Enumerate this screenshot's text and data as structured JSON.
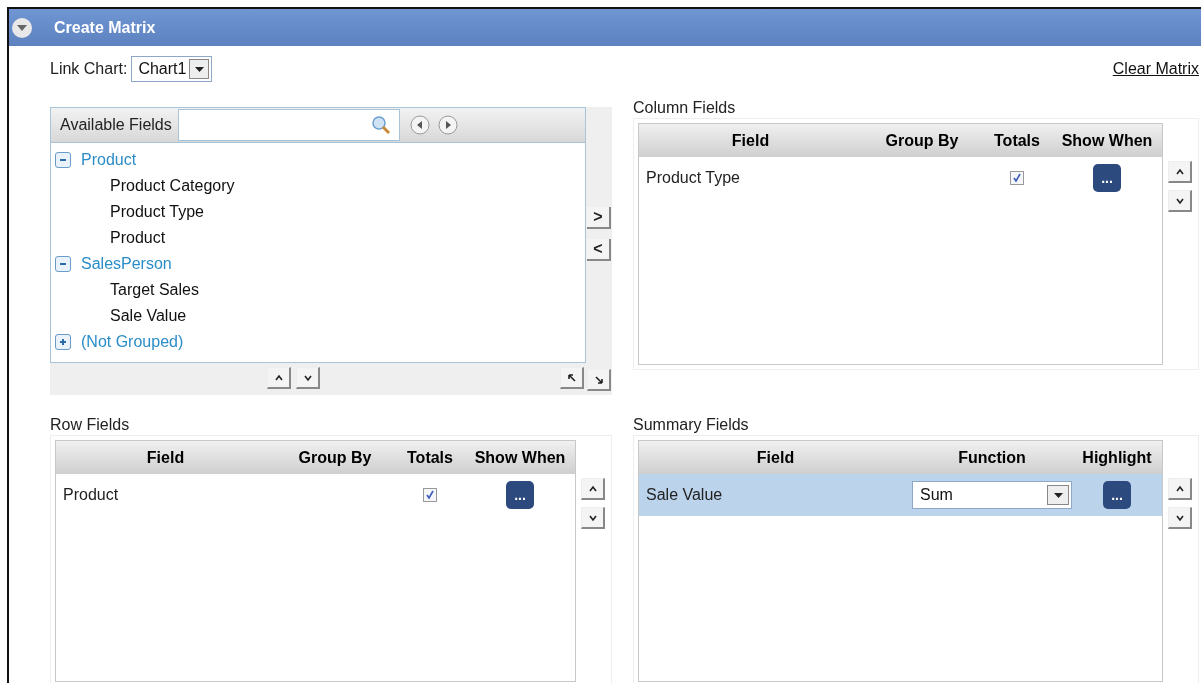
{
  "header": {
    "title": "Create Matrix",
    "expanded": true
  },
  "link_chart": {
    "label": "Link Chart:",
    "value": "Chart1"
  },
  "clear_link": "Clear Matrix",
  "available_fields": {
    "title": "Available Fields",
    "tree": [
      {
        "label": "Product",
        "expanded": true,
        "children": [
          {
            "label": "Product Category"
          },
          {
            "label": "Product Type"
          },
          {
            "label": "Product"
          }
        ]
      },
      {
        "label": "SalesPerson",
        "expanded": true,
        "children": [
          {
            "label": "Target Sales"
          },
          {
            "label": "Sale Value"
          }
        ]
      },
      {
        "label": "(Not Grouped)",
        "expanded": false
      }
    ]
  },
  "move_buttons": [
    ">",
    "<"
  ],
  "panels": [
    {
      "title": "Column Fields",
      "kind": "group",
      "columns": [
        "Field",
        "Group By",
        "Totals",
        "Show When"
      ],
      "rows": [
        {
          "field": "Product Type",
          "totals": true,
          "button": "...",
          "selected": false
        }
      ]
    },
    {
      "title": "Row Fields",
      "kind": "group",
      "columns": [
        "Field",
        "Group By",
        "Totals",
        "Show When"
      ],
      "rows": [
        {
          "field": "Product",
          "totals": true,
          "button": "...",
          "selected": false
        }
      ]
    },
    {
      "title": "Summary Fields",
      "kind": "summary",
      "columns": [
        "Field",
        "Function",
        "Highlight"
      ],
      "rows": [
        {
          "field": "Sale Value",
          "function": "Sum",
          "button": "...",
          "selected": true
        }
      ]
    }
  ]
}
